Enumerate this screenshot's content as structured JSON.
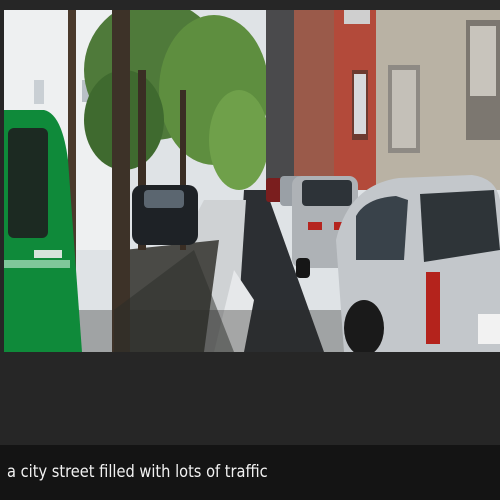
{
  "caption": {
    "text": "a city street filled with lots of traffic"
  },
  "colors": {
    "background": "#262626",
    "caption_bar": "#141414",
    "caption_text": "#f2f2f2"
  }
}
